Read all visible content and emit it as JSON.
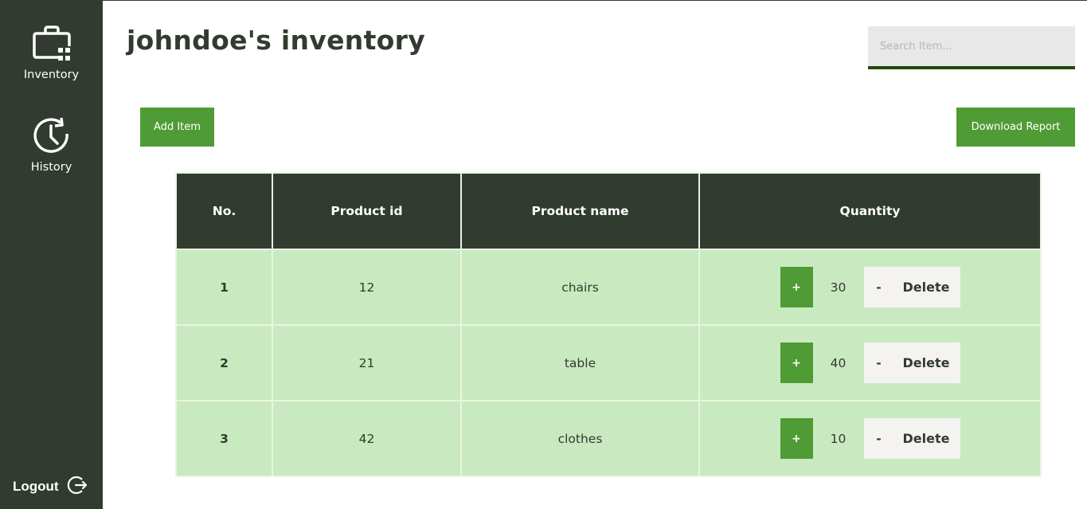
{
  "sidebar": {
    "items": [
      {
        "label": "Inventory",
        "icon": "briefcase-icon"
      },
      {
        "label": "History",
        "icon": "history-clock-icon"
      }
    ],
    "logout": {
      "label": "Logout",
      "icon": "logout-icon"
    }
  },
  "page": {
    "title": "johndoe's inventory"
  },
  "search": {
    "placeholder": "Search Item...",
    "value": ""
  },
  "toolbar": {
    "add_label": "Add Item",
    "download_label": "Download Report"
  },
  "table": {
    "headers": [
      "No.",
      "Product id",
      "Product name",
      "Quantity"
    ],
    "rows": [
      {
        "no": "1",
        "product_id": "12",
        "product_name": "chairs",
        "quantity": "30"
      },
      {
        "no": "2",
        "product_id": "21",
        "product_name": "table",
        "quantity": "40"
      },
      {
        "no": "3",
        "product_id": "42",
        "product_name": "clothes",
        "quantity": "10"
      }
    ],
    "plus_label": "+",
    "minus_label": "-",
    "delete_label": "Delete"
  },
  "colors": {
    "sidebar_bg": "#323b30",
    "accent_green": "#4f9c36",
    "row_bg": "#c9eac0",
    "search_underline": "#1d4a0c"
  }
}
